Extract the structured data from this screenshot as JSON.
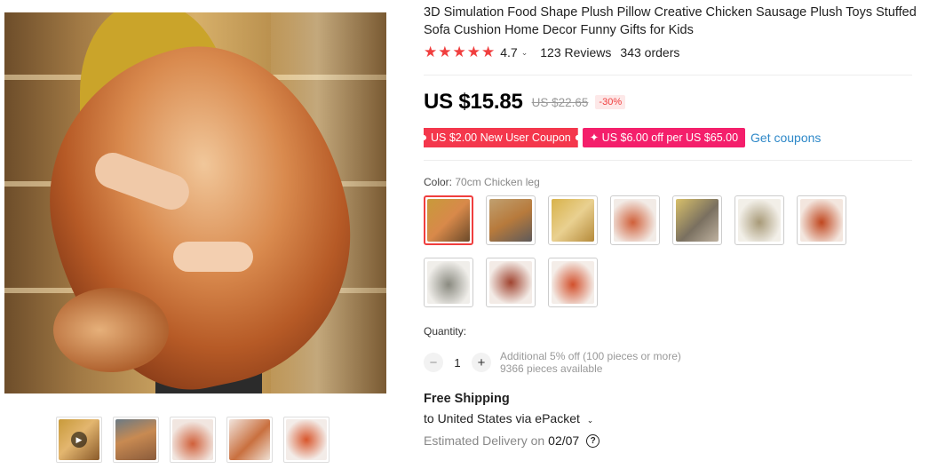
{
  "product": {
    "title": "3D Simulation Food Shape Plush Pillow Creative Chicken Sausage Plush Toys Stuffed Sofa Cushion Home Decor Funny Gifts for Kids"
  },
  "rating": {
    "stars": 5,
    "score": "4.7",
    "reviews": "123 Reviews",
    "orders": "343 orders"
  },
  "price": {
    "current": "US $15.85",
    "original": "US $22.65",
    "discount": "-30%"
  },
  "coupons": {
    "new_user": "US $2.00 New User Coupon",
    "store": "✦ US $6.00 off per US $65.00",
    "get_link": "Get coupons"
  },
  "color": {
    "label": "Color:",
    "selected": "70cm Chicken leg",
    "variant_count": 10,
    "selected_index": 0
  },
  "quantity": {
    "label": "Quantity:",
    "value": "1",
    "minus": "−",
    "plus": "+",
    "discount_note": "Additional 5% off (100 pieces or more)",
    "available": "9366 pieces available"
  },
  "shipping": {
    "title": "Free Shipping",
    "destination": "to United States via ePacket",
    "estimated_label": "Estimated Delivery on",
    "estimated_date": "02/07",
    "help_icon": "?"
  },
  "gallery": {
    "thumbnail_count": 5,
    "video_thumbnail_index": 0
  },
  "icons": {
    "star": "star-icon",
    "chevron": "chevron-down-icon",
    "play": "play-icon",
    "help": "question-circle-icon"
  },
  "colors": {
    "accent_red": "#f03e3e",
    "coupon_red": "#f4374c",
    "coupon_pink": "#f41f6b",
    "link_blue": "#2e88c8"
  }
}
